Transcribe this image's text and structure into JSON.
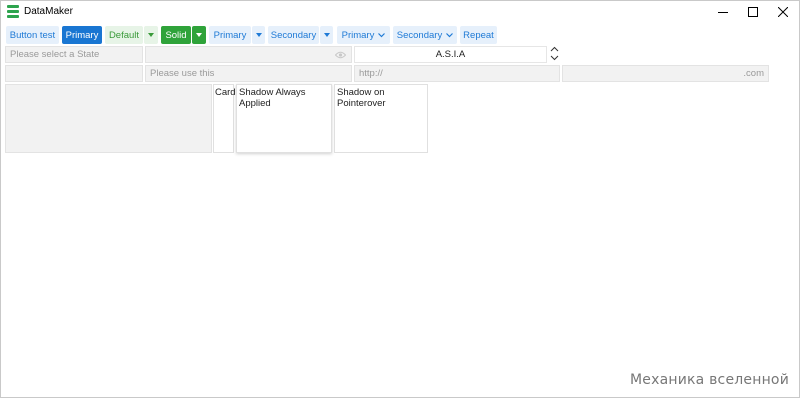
{
  "window": {
    "title": "DataMaker",
    "icon": "datamaker-app-icon",
    "controls": [
      "minimize-icon",
      "maximize-icon",
      "close-icon"
    ]
  },
  "toolbar": {
    "button_test": "Button test",
    "primary": "Primary",
    "default": "Default",
    "solid": "Solid",
    "split_primary": "Primary",
    "split_secondary": "Secondary",
    "dropdown_primary": "Primary",
    "dropdown_secondary": "Secondary",
    "repeat": "Repeat"
  },
  "inputs": {
    "state_placeholder": "Please select a State",
    "password_value": "",
    "spinner_value": "A.S.I.A",
    "empty_field_value": "",
    "use_this_placeholder": "Please use this",
    "url_prefix": "http://",
    "url_suffix": ".com"
  },
  "cards": {
    "card_label": "Card",
    "shadow_always": "Shadow Always Applied",
    "shadow_pointer": "Shadow on Pointerover"
  },
  "watermark": "Механика вселенной",
  "colors": {
    "accent_blue": "#1976d2",
    "light_blue": "#e6f0fb",
    "accent_green": "#2fa33a",
    "light_green": "#e7f4e7"
  }
}
